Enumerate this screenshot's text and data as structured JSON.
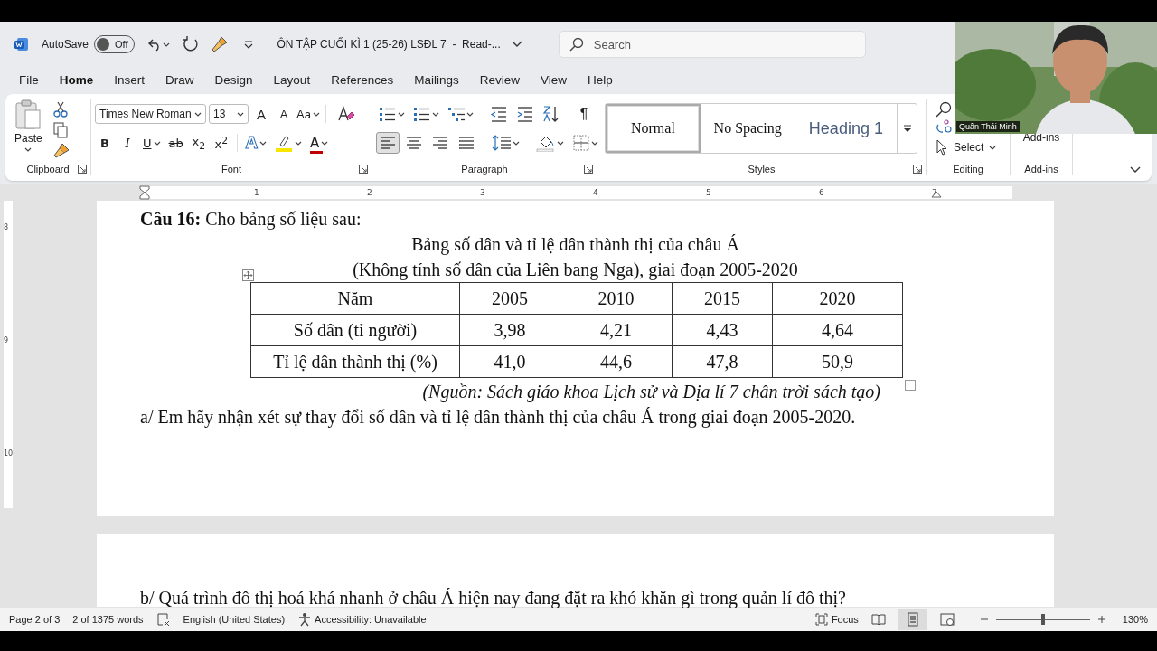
{
  "title_bar": {
    "autosave_label": "AutoSave",
    "autosave": {
      "label": "Off",
      "on": false
    },
    "document_title": "ÔN TẬP CUỐI KÌ 1 (25-26) LSĐL 7  -  Read-...",
    "search": {
      "placeholder": "Search"
    }
  },
  "menu_tabs": [
    {
      "label": "File",
      "selected": false
    },
    {
      "label": "Home",
      "selected": true
    },
    {
      "label": "Insert",
      "selected": false
    },
    {
      "label": "Draw",
      "selected": false
    },
    {
      "label": "Design",
      "selected": false
    },
    {
      "label": "Layout",
      "selected": false
    },
    {
      "label": "References",
      "selected": false
    },
    {
      "label": "Mailings",
      "selected": false
    },
    {
      "label": "Review",
      "selected": false
    },
    {
      "label": "View",
      "selected": false
    },
    {
      "label": "Help",
      "selected": false
    }
  ],
  "ribbon": {
    "clipboard": {
      "paste_label": "Paste",
      "group_label": "Clipboard"
    },
    "font": {
      "font_name": "Times New Roman",
      "font_size": "13",
      "size_buttons": [
        {
          "kind": "grow",
          "label": "A"
        },
        {
          "kind": "shrink",
          "label": "A"
        },
        {
          "kind": "case",
          "label": "Aa"
        }
      ],
      "format_buttons": [
        {
          "kind": "bold",
          "label": "B"
        },
        {
          "kind": "italic",
          "label": "I"
        },
        {
          "kind": "underline",
          "label": "U"
        },
        {
          "kind": "strike",
          "label": "ab"
        },
        {
          "kind": "sub",
          "label": "x$_{2}$"
        },
        {
          "kind": "sup",
          "label": "x$^{2}$"
        },
        {
          "kind": "effects",
          "label": "A"
        },
        {
          "kind": "highlight"
        },
        {
          "kind": "color",
          "label": "A"
        }
      ],
      "group_label": "Font"
    },
    "paragraph": {
      "pilcrow": "¶",
      "alignments": [
        {
          "kind": "left",
          "selected": true
        },
        {
          "kind": "center",
          "selected": false
        },
        {
          "kind": "right",
          "selected": false
        },
        {
          "kind": "justify",
          "selected": false
        }
      ],
      "group_label": "Paragraph"
    },
    "styles": {
      "items": [
        {
          "label": "Normal",
          "kind": "normal",
          "selected": true
        },
        {
          "label": "No Spacing",
          "kind": "plain",
          "selected": false
        },
        {
          "label": "Heading 1",
          "kind": "heading",
          "selected": false
        }
      ],
      "group_label": "Styles"
    },
    "editing": {
      "select_label": "Select",
      "group_label": "Editing"
    },
    "add_ins": {
      "button_label": "Add-ins",
      "group_label": "Add-ins"
    }
  },
  "ruler": {
    "marks": [
      "1",
      "2",
      "3",
      "4",
      "5",
      "6",
      "7"
    ]
  },
  "vertical_ruler": {
    "marks": [
      "8",
      "9",
      "10"
    ]
  },
  "document": {
    "question": "**Câu 16:** Cho bảng số liệu sau:",
    "table_title": [
      "Bảng số dân và tỉ lệ dân thành thị của châu Á",
      "(Không tính số dân của Liên bang Nga), giai đoạn 2005-2020"
    ],
    "table": {
      "header": [
        "Năm",
        "2005",
        "2010",
        "2015",
        "2020"
      ],
      "rows": [
        [
          "Số dân (tỉ người)",
          "3,98",
          "4,21",
          "4,43",
          "4,64"
        ],
        [
          "Tỉ lệ dân thành thị (%)",
          "41,0",
          "44,6",
          "47,8",
          "50,9"
        ]
      ]
    },
    "source": "(Nguồn: Sách giáo khoa Lịch sử và Địa lí 7 chân trời sách tạo)",
    "question_a": "a/ Em hãy nhận xét sự thay đổi số dân và tỉ lệ dân thành thị của châu Á trong giai đoạn 2005-2020.",
    "question_b": "b/ Quá trình đô thị hoá khá nhanh ở châu Á hiện nay đang đặt ra khó khăn gì trong quản lí đô thị?"
  },
  "status_bar": {
    "page": "Page 2 of 3",
    "words": "2 of 1375 words",
    "language": "English (United States)",
    "accessibility": "Accessibility: Unavailable",
    "focus": "Focus",
    "views": [
      {
        "kind": "read",
        "selected": false
      },
      {
        "kind": "print",
        "selected": true
      },
      {
        "kind": "web",
        "selected": false
      }
    ],
    "zoom_slider": {
      "level": 0.5
    },
    "zoom": "130%"
  },
  "video_overlay": {
    "kind": "picture",
    "name": "Quân Thái Minh"
  }
}
